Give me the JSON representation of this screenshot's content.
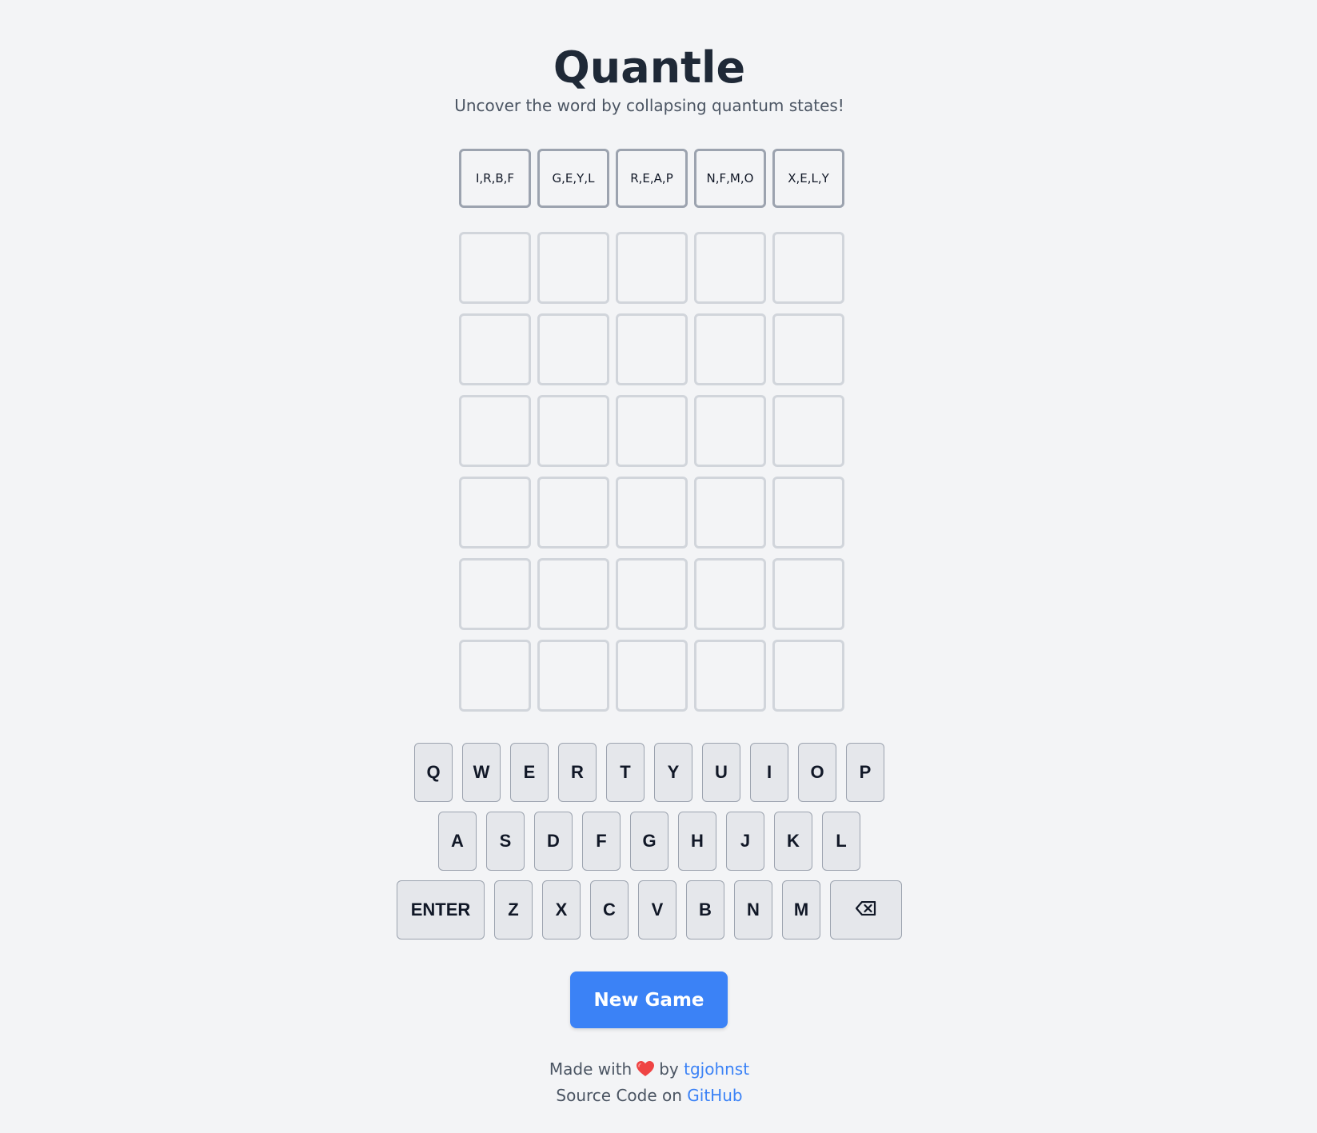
{
  "header": {
    "title": "Quantle",
    "subtitle": "Uncover the word by collapsing quantum states!"
  },
  "quantum_states": [
    "I,R,B,F",
    "G,E,Y,L",
    "R,E,A,P",
    "N,F,M,O",
    "X,E,L,Y"
  ],
  "board": {
    "rows": 6,
    "columns": 5,
    "guesses": [
      [
        "",
        "",
        "",
        "",
        ""
      ],
      [
        "",
        "",
        "",
        "",
        ""
      ],
      [
        "",
        "",
        "",
        "",
        ""
      ],
      [
        "",
        "",
        "",
        "",
        ""
      ],
      [
        "",
        "",
        "",
        "",
        ""
      ],
      [
        "",
        "",
        "",
        "",
        ""
      ]
    ]
  },
  "keyboard": {
    "row1": [
      "Q",
      "W",
      "E",
      "R",
      "T",
      "Y",
      "U",
      "I",
      "O",
      "P"
    ],
    "row2": [
      "A",
      "S",
      "D",
      "F",
      "G",
      "H",
      "J",
      "K",
      "L"
    ],
    "row3": [
      "ENTER",
      "Z",
      "X",
      "C",
      "V",
      "B",
      "N",
      "M",
      "⌫"
    ]
  },
  "actions": {
    "new_game_label": "New Game"
  },
  "footer": {
    "made_with": "Made with",
    "heart_icon": "heart-icon",
    "by": "by",
    "author": "tgjohnst",
    "source_code": "Source Code on",
    "github": "GitHub"
  },
  "colors": {
    "background": "#f3f4f6",
    "accent": "#3b82f6",
    "heart": "#ef4444"
  }
}
